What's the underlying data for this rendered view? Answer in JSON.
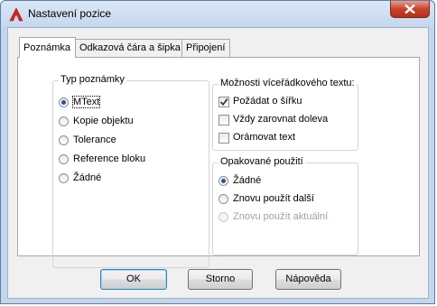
{
  "window": {
    "title": "Nastavení pozice",
    "icon": "autocad-a-icon",
    "accent_color": "#c7432b"
  },
  "tabs": [
    {
      "label": "Poznámka",
      "active": true
    },
    {
      "label": "Odkazová čára a šipka",
      "active": false
    },
    {
      "label": "Připojení",
      "active": false
    }
  ],
  "annotation_type": {
    "title": "Typ poznámky",
    "options": [
      {
        "label": "MText",
        "checked": true
      },
      {
        "label": "Kopie objektu",
        "checked": false
      },
      {
        "label": "Tolerance",
        "checked": false
      },
      {
        "label": "Reference bloku",
        "checked": false
      },
      {
        "label": "Žádné",
        "checked": false
      }
    ]
  },
  "mtext_options": {
    "title": "Možnosti víceřádkového textu:",
    "options": [
      {
        "label": "Požádat o šířku",
        "checked": true
      },
      {
        "label": "Vždy zarovnat doleva",
        "checked": false
      },
      {
        "label": "Orámovat text",
        "checked": false
      }
    ]
  },
  "reuse": {
    "title": "Opakované použití",
    "options": [
      {
        "label": "Žádné",
        "checked": true,
        "enabled": true
      },
      {
        "label": "Znovu použít další",
        "checked": false,
        "enabled": true
      },
      {
        "label": "Znovu použít aktuální",
        "checked": false,
        "enabled": false
      }
    ]
  },
  "buttons": {
    "ok": "OK",
    "cancel": "Storno",
    "help": "Nápověda"
  }
}
